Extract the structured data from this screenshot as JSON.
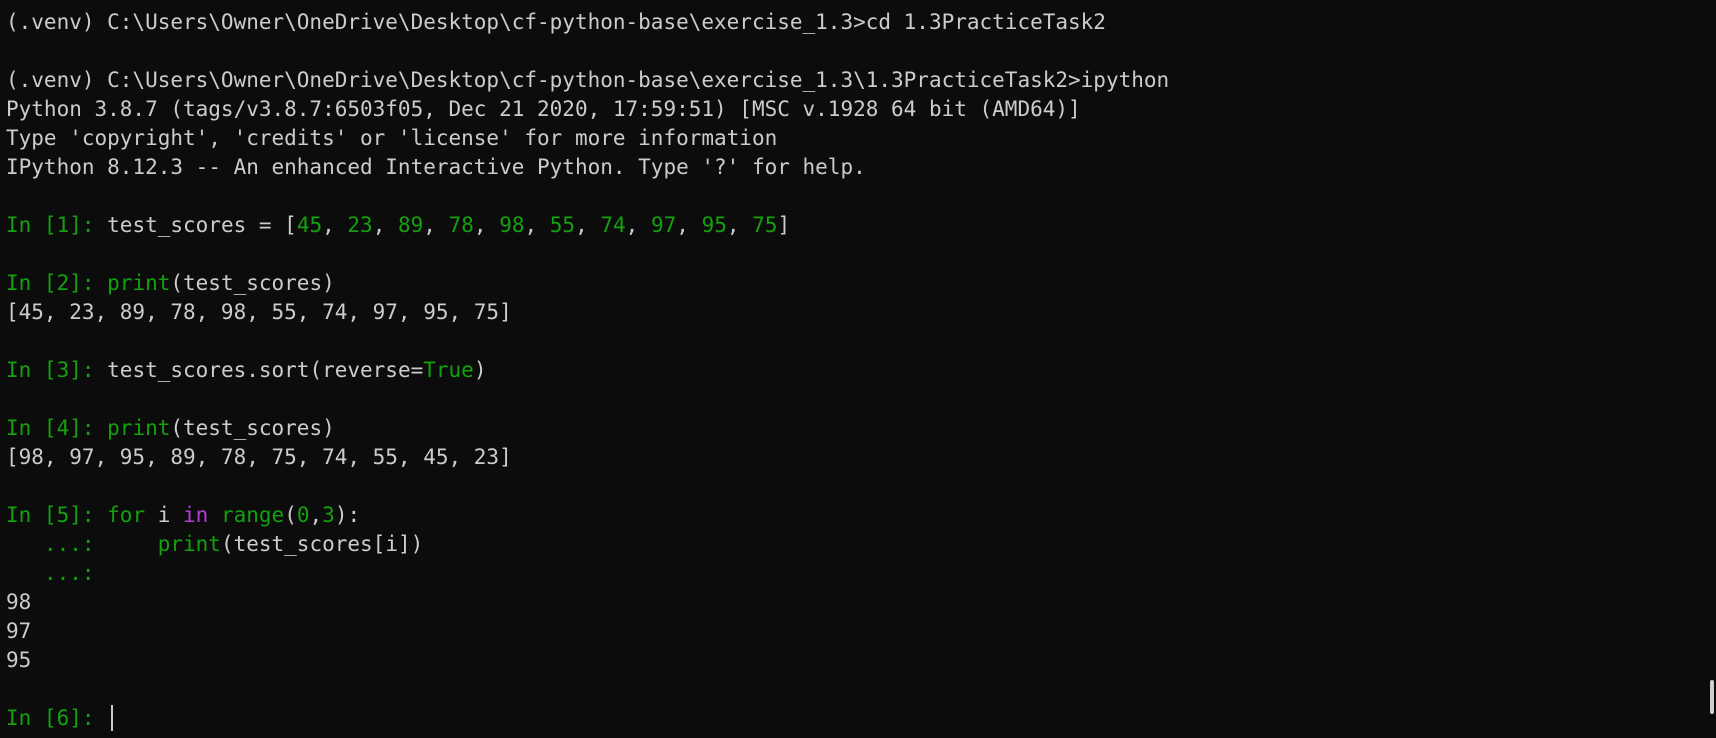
{
  "terminal": {
    "lines": [
      [
        {
          "t": "(.venv) C:\\Users\\Owner\\OneDrive\\Desktop\\cf-python-base\\exercise_1.3>cd 1.3PracticeTask2",
          "c": "default"
        }
      ],
      [],
      [
        {
          "t": "(.venv) C:\\Users\\Owner\\OneDrive\\Desktop\\cf-python-base\\exercise_1.3\\1.3PracticeTask2>ipython",
          "c": "default"
        }
      ],
      [
        {
          "t": "Python 3.8.7 (tags/v3.8.7:6503f05, Dec 21 2020, 17:59:51) [MSC v.1928 64 bit (AMD64)]",
          "c": "default"
        }
      ],
      [
        {
          "t": "Type 'copyright', 'credits' or 'license' for more information",
          "c": "default"
        }
      ],
      [
        {
          "t": "IPython 8.12.3 -- An enhanced Interactive Python. Type '?' for help.",
          "c": "default"
        }
      ],
      [],
      [
        {
          "t": "In [1]: ",
          "c": "prompt"
        },
        {
          "t": "test_scores = [",
          "c": "default"
        },
        {
          "t": "45",
          "c": "num"
        },
        {
          "t": ", ",
          "c": "default"
        },
        {
          "t": "23",
          "c": "num"
        },
        {
          "t": ", ",
          "c": "default"
        },
        {
          "t": "89",
          "c": "num"
        },
        {
          "t": ", ",
          "c": "default"
        },
        {
          "t": "78",
          "c": "num"
        },
        {
          "t": ", ",
          "c": "default"
        },
        {
          "t": "98",
          "c": "num"
        },
        {
          "t": ", ",
          "c": "default"
        },
        {
          "t": "55",
          "c": "num"
        },
        {
          "t": ", ",
          "c": "default"
        },
        {
          "t": "74",
          "c": "num"
        },
        {
          "t": ", ",
          "c": "default"
        },
        {
          "t": "97",
          "c": "num"
        },
        {
          "t": ", ",
          "c": "default"
        },
        {
          "t": "95",
          "c": "num"
        },
        {
          "t": ", ",
          "c": "default"
        },
        {
          "t": "75",
          "c": "num"
        },
        {
          "t": "]",
          "c": "default"
        }
      ],
      [],
      [
        {
          "t": "In [2]: ",
          "c": "prompt"
        },
        {
          "t": "print",
          "c": "builtin"
        },
        {
          "t": "(test_scores)",
          "c": "default"
        }
      ],
      [
        {
          "t": "[45, 23, 89, 78, 98, 55, 74, 97, 95, 75]",
          "c": "default"
        }
      ],
      [],
      [
        {
          "t": "In [3]: ",
          "c": "prompt"
        },
        {
          "t": "test_scores.sort(reverse=",
          "c": "default"
        },
        {
          "t": "True",
          "c": "kwgreen"
        },
        {
          "t": ")",
          "c": "default"
        }
      ],
      [],
      [
        {
          "t": "In [4]: ",
          "c": "prompt"
        },
        {
          "t": "print",
          "c": "builtin"
        },
        {
          "t": "(test_scores)",
          "c": "default"
        }
      ],
      [
        {
          "t": "[98, 97, 95, 89, 78, 75, 74, 55, 45, 23]",
          "c": "default"
        }
      ],
      [],
      [
        {
          "t": "In [5]: ",
          "c": "prompt"
        },
        {
          "t": "for",
          "c": "kwgreen"
        },
        {
          "t": " i ",
          "c": "default"
        },
        {
          "t": "in",
          "c": "kwpurple"
        },
        {
          "t": " ",
          "c": "default"
        },
        {
          "t": "range",
          "c": "builtin"
        },
        {
          "t": "(",
          "c": "default"
        },
        {
          "t": "0",
          "c": "num"
        },
        {
          "t": ",",
          "c": "default"
        },
        {
          "t": "3",
          "c": "num"
        },
        {
          "t": "):",
          "c": "default"
        }
      ],
      [
        {
          "t": "   ...: ",
          "c": "prompt"
        },
        {
          "t": "    ",
          "c": "default"
        },
        {
          "t": "print",
          "c": "builtin"
        },
        {
          "t": "(test_scores[i])",
          "c": "default"
        }
      ],
      [
        {
          "t": "   ...: ",
          "c": "prompt"
        }
      ],
      [
        {
          "t": "98",
          "c": "default"
        }
      ],
      [
        {
          "t": "97",
          "c": "default"
        }
      ],
      [
        {
          "t": "95",
          "c": "default"
        }
      ],
      [],
      [
        {
          "t": "In [6]: ",
          "c": "prompt"
        }
      ]
    ],
    "cursor_line": 24
  },
  "colors": {
    "background": "#0c0c0c",
    "foreground": "#cccccc",
    "prompt_green": "#13a10e",
    "keyword_purple": "#b53bd6"
  }
}
